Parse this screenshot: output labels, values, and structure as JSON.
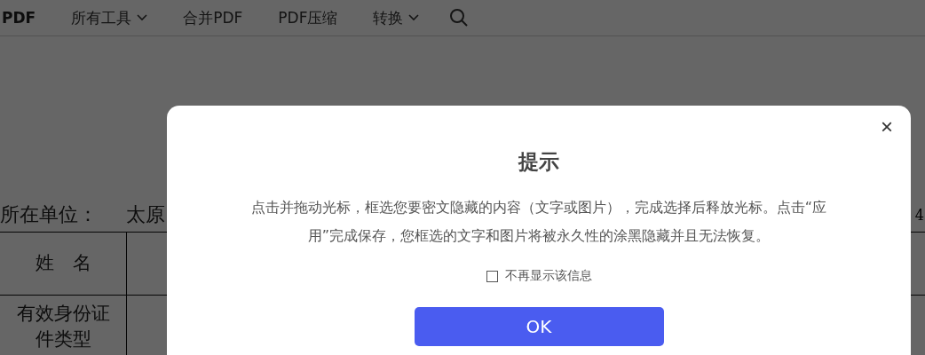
{
  "nav": {
    "logo": "PDF",
    "items": [
      {
        "label": "所有工具",
        "dropdown": true
      },
      {
        "label": "合并PDF",
        "dropdown": false
      },
      {
        "label": "PDF压缩",
        "dropdown": false
      },
      {
        "label": "转换",
        "dropdown": true
      }
    ]
  },
  "document": {
    "unit_label": "所在单位：",
    "unit_value": "太原",
    "page_number": "4",
    "rows": [
      {
        "label": "姓　名"
      },
      {
        "label": "有效身份证件类型"
      }
    ]
  },
  "dialog": {
    "close": "×",
    "title": "提示",
    "message": "点击并拖动光标，框选您要密文隐藏的内容（文字或图片），完成选择后释放光标。点击“应用”完成保存，您框选的文字和图片将被永久性的涂黑隐藏并且无法恢复。",
    "checkbox": {
      "label": "不再显示该信息",
      "checked": false
    },
    "ok_button": "OK"
  }
}
